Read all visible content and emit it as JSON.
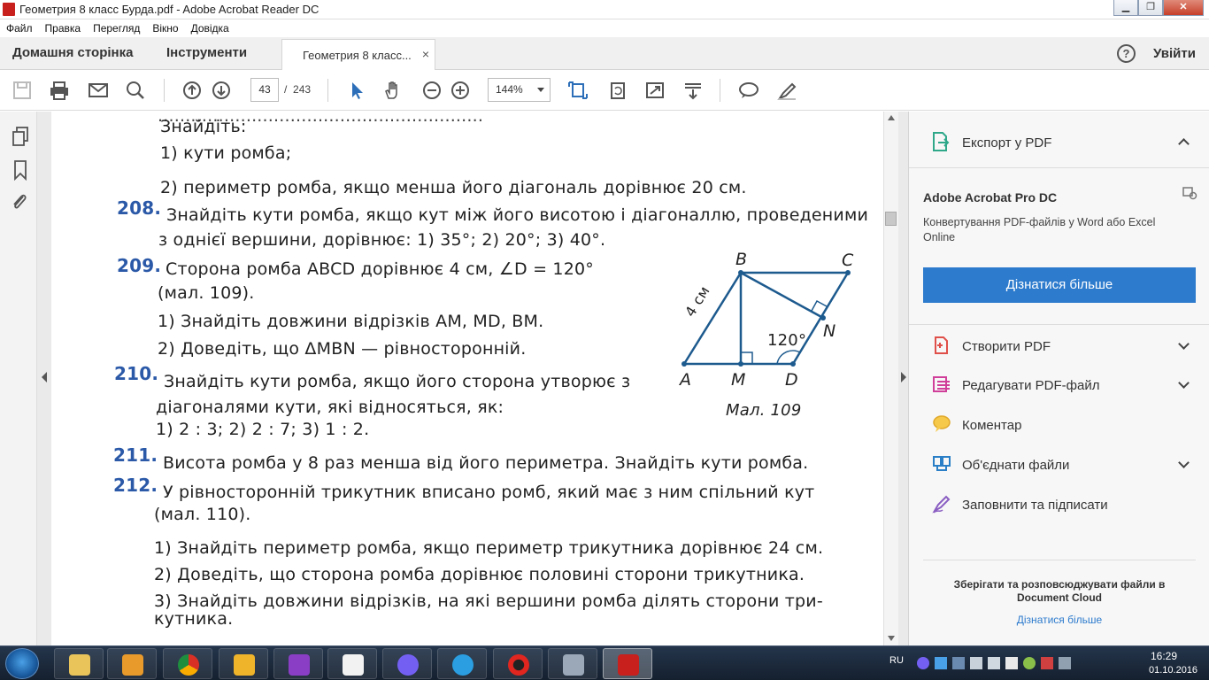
{
  "window": {
    "title": "Геометрия 8 класс Бурда.pdf - Adobe Acrobat Reader DC",
    "minimize": "▁",
    "maximize": "❐",
    "close": "✕"
  },
  "menu": [
    "Файл",
    "Правка",
    "Перегляд",
    "Вікно",
    "Довідка"
  ],
  "tabs": {
    "home": "Домашня сторінка",
    "tools": "Інструменти",
    "document": "Геометрия 8 класс...",
    "close": "×",
    "help": "?",
    "login": "Увійти"
  },
  "toolbar": {
    "page_current": "43",
    "page_separator": "/",
    "page_total": "243",
    "zoom": "144%"
  },
  "document": {
    "lines": {
      "l0": "Знайдіть:",
      "l1": "1) кути ромба;",
      "l2": "2) периметр ромба, якщо менша його діагональ дорівнює 20 см.",
      "n208": "208.",
      "l208a": "Знайдіть кути ромба, якщо кут між його висотою і діагоналлю, проведеними",
      "l208b": "з однієї вершини, дорівнює:    1) 35°;    2) 20°;    3) 40°.",
      "n209": "209.",
      "l209a": "Сторона ромба ABCD дорівнює 4 см, ∠D = 120°",
      "l209b": "(мал. 109).",
      "l209c": "1)  Знайдіть довжини відрізків AM, MD, BM.",
      "l209d": "2)  Доведіть, що ΔMBN — рівносторонній.",
      "n210": "210.",
      "l210a": "Знайдіть кути ромба, якщо його сторона утворює з",
      "l210b": "діагоналями кути, які відносяться, як:",
      "l210c": "1) 2 : 3;    2) 2 : 7;    3) 1 : 2.",
      "n211": "211.",
      "l211": "Висота ромба у 8 раз менша від його периметра. Знайдіть кути ромба.",
      "n212": "212.",
      "l212a": "У рівносторонній трикутник вписано ромб, який має з ним спільний кут",
      "l212b": "(мал. 110).",
      "l212c": "1)  Знайдіть периметр ромба, якщо периметр трикутника дорівнює 24 см.",
      "l212d": "2)  Доведіть, що сторона ромба дорівнює половині сторони трикутника.",
      "l212e": "3)  Знайдіть довжини відрізків, на які вершини ромба ділять сторони три-",
      "l212f": "кутника."
    },
    "figure": {
      "caption": "Мал. 109",
      "A": "A",
      "B": "B",
      "C": "C",
      "D": "D",
      "M": "M",
      "N": "N",
      "side": "4 см",
      "angle": "120°"
    }
  },
  "right_panel": {
    "export_title": "Експорт у PDF",
    "product": "Adobe Acrobat Pro DC",
    "description_1": "Конвертування PDF-файлів у Word або Excel",
    "description_2": "Online",
    "learn_more_button": "Дізнатися більше",
    "tools": [
      "Створити PDF",
      "Редагувати PDF-файл",
      "Коментар",
      "Об'єднати файли",
      "Заповнити та підписати"
    ],
    "cloud_1": "Зберігати та розповсюджувати файли в",
    "cloud_2": "Document Cloud",
    "cloud_link": "Дізнатися більше"
  },
  "taskbar": {
    "lang": "RU",
    "time": "16:29",
    "date": "01.10.2016"
  },
  "colors": {
    "accent": "#2d7bcd",
    "problem_number": "#2b59a8",
    "pdf_red": "#c8201d"
  }
}
